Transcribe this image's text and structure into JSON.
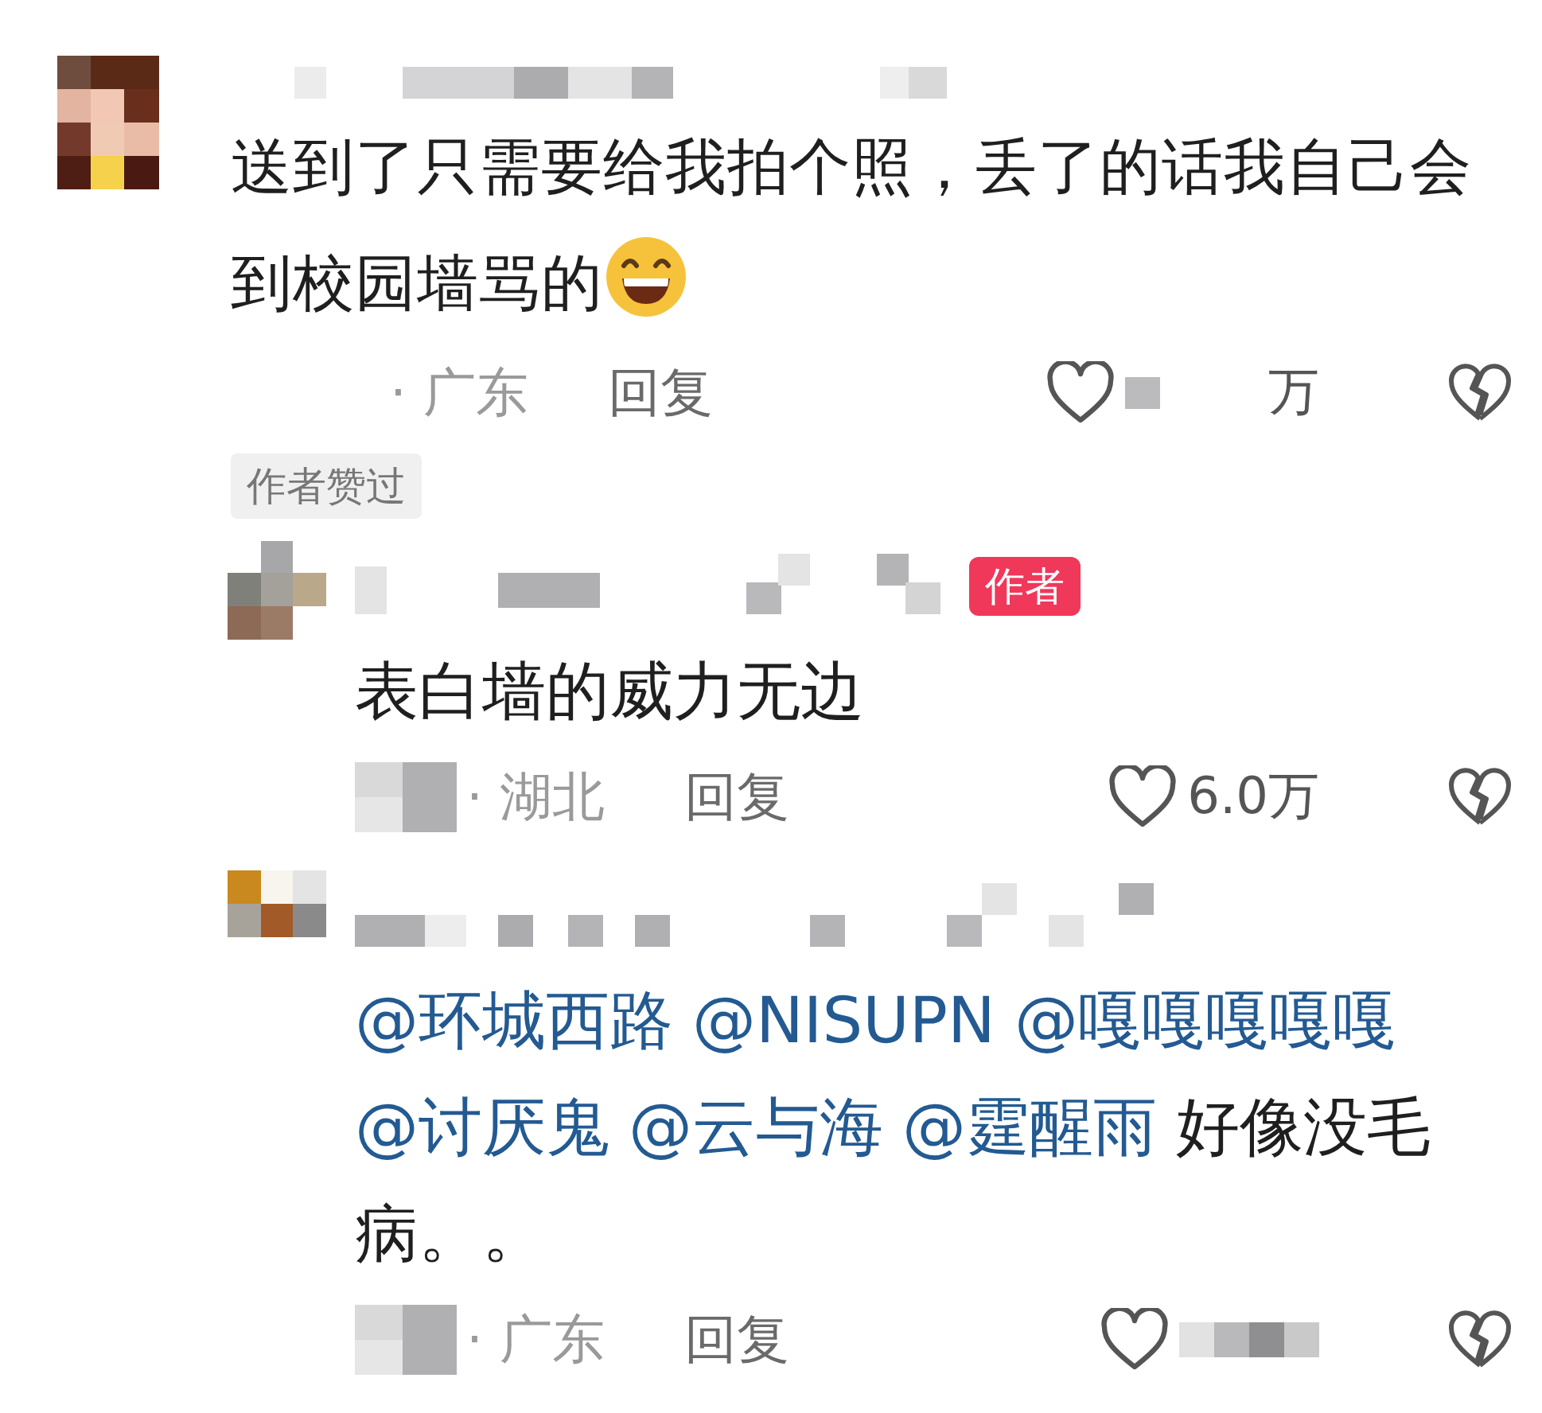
{
  "comments": [
    {
      "segments": [
        {
          "kind": "text",
          "text": "送到了只需要给我拍个照，丢了的话我自己会到校园墙骂的"
        },
        {
          "kind": "emoji"
        }
      ],
      "location": "· 广东",
      "reply": "回复",
      "likes": "万",
      "author_liked": "作者赞过",
      "replies": [
        {
          "author_badge": "作者",
          "segments": [
            {
              "kind": "text",
              "text": "表白墙的威力无边"
            }
          ],
          "location": "· 湖北",
          "reply": "回复",
          "likes": "6.0万"
        },
        {
          "segments": [
            {
              "kind": "mention",
              "text": "@环城西路"
            },
            {
              "kind": "mention",
              "text": "@NISUPN"
            },
            {
              "kind": "mention",
              "text": "@嘎嘎嘎嘎嘎"
            },
            {
              "kind": "mention",
              "text": "@讨厌鬼"
            },
            {
              "kind": "mention",
              "text": "@云与海"
            },
            {
              "kind": "mention",
              "text": "@霆醒雨"
            },
            {
              "kind": "text",
              "text": "好像没毛病。。"
            }
          ],
          "location": "· 广东",
          "reply": "回复"
        }
      ]
    }
  ]
}
